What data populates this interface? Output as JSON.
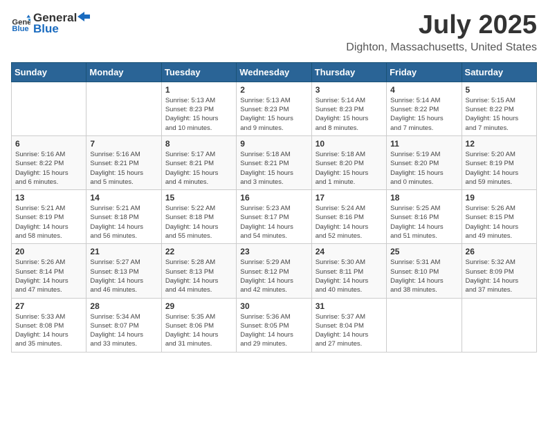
{
  "logo": {
    "text_general": "General",
    "text_blue": "Blue"
  },
  "header": {
    "title": "July 2025",
    "subtitle": "Dighton, Massachusetts, United States"
  },
  "weekdays": [
    "Sunday",
    "Monday",
    "Tuesday",
    "Wednesday",
    "Thursday",
    "Friday",
    "Saturday"
  ],
  "weeks": [
    [
      {
        "day": "",
        "info": ""
      },
      {
        "day": "",
        "info": ""
      },
      {
        "day": "1",
        "info": "Sunrise: 5:13 AM\nSunset: 8:23 PM\nDaylight: 15 hours\nand 10 minutes."
      },
      {
        "day": "2",
        "info": "Sunrise: 5:13 AM\nSunset: 8:23 PM\nDaylight: 15 hours\nand 9 minutes."
      },
      {
        "day": "3",
        "info": "Sunrise: 5:14 AM\nSunset: 8:23 PM\nDaylight: 15 hours\nand 8 minutes."
      },
      {
        "day": "4",
        "info": "Sunrise: 5:14 AM\nSunset: 8:22 PM\nDaylight: 15 hours\nand 7 minutes."
      },
      {
        "day": "5",
        "info": "Sunrise: 5:15 AM\nSunset: 8:22 PM\nDaylight: 15 hours\nand 7 minutes."
      }
    ],
    [
      {
        "day": "6",
        "info": "Sunrise: 5:16 AM\nSunset: 8:22 PM\nDaylight: 15 hours\nand 6 minutes."
      },
      {
        "day": "7",
        "info": "Sunrise: 5:16 AM\nSunset: 8:21 PM\nDaylight: 15 hours\nand 5 minutes."
      },
      {
        "day": "8",
        "info": "Sunrise: 5:17 AM\nSunset: 8:21 PM\nDaylight: 15 hours\nand 4 minutes."
      },
      {
        "day": "9",
        "info": "Sunrise: 5:18 AM\nSunset: 8:21 PM\nDaylight: 15 hours\nand 3 minutes."
      },
      {
        "day": "10",
        "info": "Sunrise: 5:18 AM\nSunset: 8:20 PM\nDaylight: 15 hours\nand 1 minute."
      },
      {
        "day": "11",
        "info": "Sunrise: 5:19 AM\nSunset: 8:20 PM\nDaylight: 15 hours\nand 0 minutes."
      },
      {
        "day": "12",
        "info": "Sunrise: 5:20 AM\nSunset: 8:19 PM\nDaylight: 14 hours\nand 59 minutes."
      }
    ],
    [
      {
        "day": "13",
        "info": "Sunrise: 5:21 AM\nSunset: 8:19 PM\nDaylight: 14 hours\nand 58 minutes."
      },
      {
        "day": "14",
        "info": "Sunrise: 5:21 AM\nSunset: 8:18 PM\nDaylight: 14 hours\nand 56 minutes."
      },
      {
        "day": "15",
        "info": "Sunrise: 5:22 AM\nSunset: 8:18 PM\nDaylight: 14 hours\nand 55 minutes."
      },
      {
        "day": "16",
        "info": "Sunrise: 5:23 AM\nSunset: 8:17 PM\nDaylight: 14 hours\nand 54 minutes."
      },
      {
        "day": "17",
        "info": "Sunrise: 5:24 AM\nSunset: 8:16 PM\nDaylight: 14 hours\nand 52 minutes."
      },
      {
        "day": "18",
        "info": "Sunrise: 5:25 AM\nSunset: 8:16 PM\nDaylight: 14 hours\nand 51 minutes."
      },
      {
        "day": "19",
        "info": "Sunrise: 5:26 AM\nSunset: 8:15 PM\nDaylight: 14 hours\nand 49 minutes."
      }
    ],
    [
      {
        "day": "20",
        "info": "Sunrise: 5:26 AM\nSunset: 8:14 PM\nDaylight: 14 hours\nand 47 minutes."
      },
      {
        "day": "21",
        "info": "Sunrise: 5:27 AM\nSunset: 8:13 PM\nDaylight: 14 hours\nand 46 minutes."
      },
      {
        "day": "22",
        "info": "Sunrise: 5:28 AM\nSunset: 8:13 PM\nDaylight: 14 hours\nand 44 minutes."
      },
      {
        "day": "23",
        "info": "Sunrise: 5:29 AM\nSunset: 8:12 PM\nDaylight: 14 hours\nand 42 minutes."
      },
      {
        "day": "24",
        "info": "Sunrise: 5:30 AM\nSunset: 8:11 PM\nDaylight: 14 hours\nand 40 minutes."
      },
      {
        "day": "25",
        "info": "Sunrise: 5:31 AM\nSunset: 8:10 PM\nDaylight: 14 hours\nand 38 minutes."
      },
      {
        "day": "26",
        "info": "Sunrise: 5:32 AM\nSunset: 8:09 PM\nDaylight: 14 hours\nand 37 minutes."
      }
    ],
    [
      {
        "day": "27",
        "info": "Sunrise: 5:33 AM\nSunset: 8:08 PM\nDaylight: 14 hours\nand 35 minutes."
      },
      {
        "day": "28",
        "info": "Sunrise: 5:34 AM\nSunset: 8:07 PM\nDaylight: 14 hours\nand 33 minutes."
      },
      {
        "day": "29",
        "info": "Sunrise: 5:35 AM\nSunset: 8:06 PM\nDaylight: 14 hours\nand 31 minutes."
      },
      {
        "day": "30",
        "info": "Sunrise: 5:36 AM\nSunset: 8:05 PM\nDaylight: 14 hours\nand 29 minutes."
      },
      {
        "day": "31",
        "info": "Sunrise: 5:37 AM\nSunset: 8:04 PM\nDaylight: 14 hours\nand 27 minutes."
      },
      {
        "day": "",
        "info": ""
      },
      {
        "day": "",
        "info": ""
      }
    ]
  ]
}
